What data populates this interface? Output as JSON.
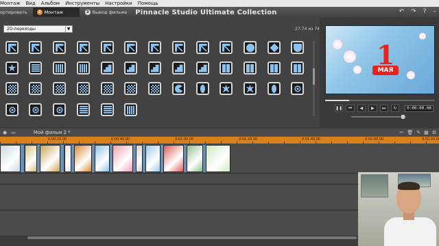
{
  "menu": [
    "Монтаж",
    "Вид",
    "Альбом",
    "Инструменты",
    "Настройки",
    "Помощь"
  ],
  "tabs": [
    {
      "num": "",
      "label": "ортировать",
      "active": false
    },
    {
      "num": "2",
      "label": "Монтаж",
      "active": true
    },
    {
      "num": "3",
      "label": "Вывод фильма",
      "active": false
    }
  ],
  "app_title": "Pinnacle Studio Ultimate Collection",
  "library": {
    "category": "2D-переходы",
    "count_label": "27-74 из 74"
  },
  "preview": {
    "overlay_big": "1",
    "overlay_word": "МАЯ",
    "timecode": "0:00:00.06",
    "progress": 0.22,
    "volume": 0.95
  },
  "timeline": {
    "project_name": "Мой фильм 2 *",
    "ruler_ticks": [
      "0:00:20.00",
      "0:00:40.00",
      "0:01:00.00",
      "0:01:20.00",
      "0:01:40.00",
      "0:02:00.00",
      "0:02:20.00"
    ]
  },
  "colors": {
    "accent": "#f08a1c",
    "ruler": "#d9801a",
    "transition_icon": "#8ec2ee"
  }
}
